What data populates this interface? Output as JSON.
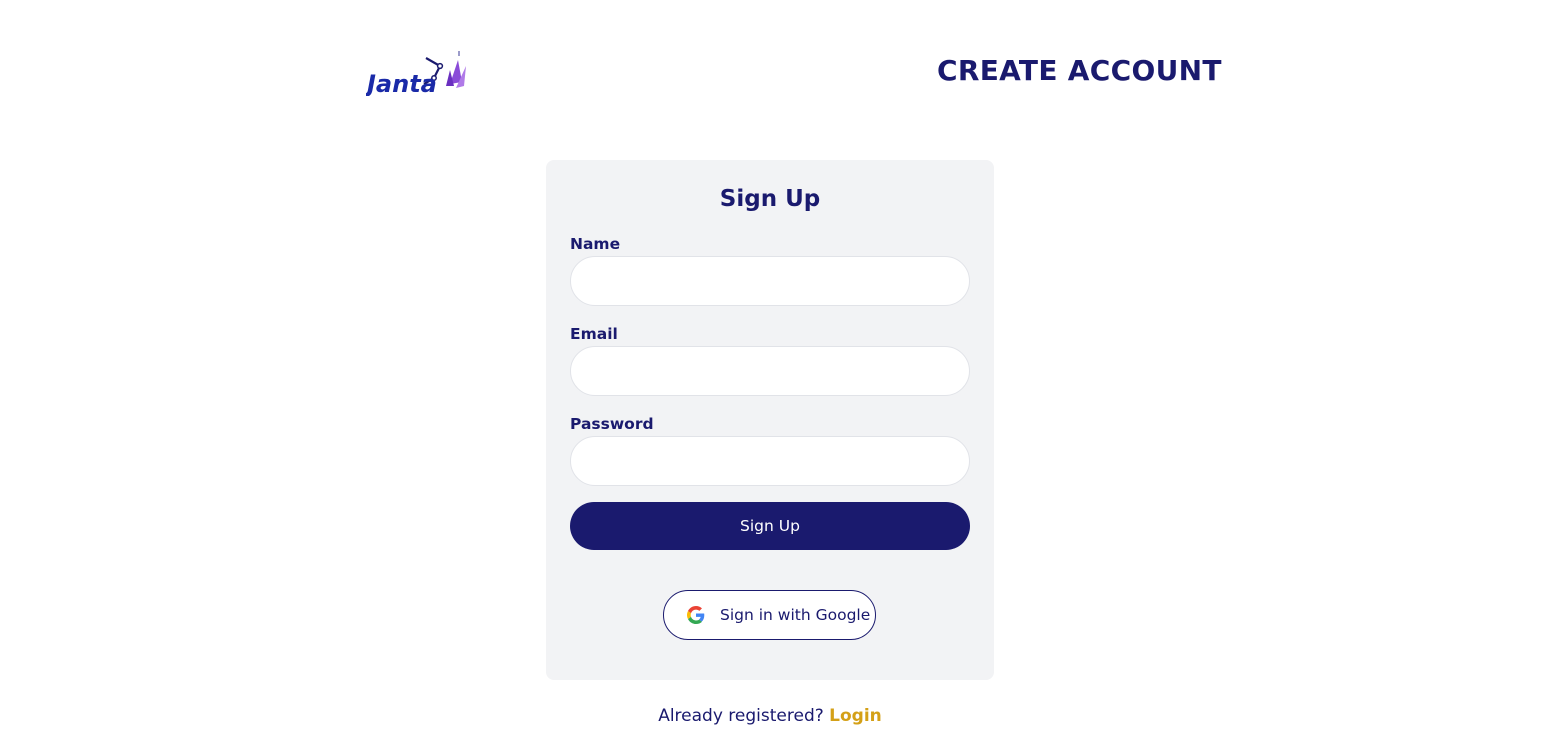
{
  "header": {
    "logo_text": "Janta",
    "page_title": "CREATE ACCOUNT"
  },
  "form": {
    "title": "Sign Up",
    "fields": [
      {
        "label": "Name",
        "value": "",
        "placeholder": ""
      },
      {
        "label": "Email",
        "value": "",
        "placeholder": ""
      },
      {
        "label": "Password",
        "value": "",
        "placeholder": ""
      }
    ],
    "submit_label": "Sign Up",
    "google_label": "Sign in with Google"
  },
  "footer": {
    "prompt": "Already registered?",
    "login_label": "Login"
  },
  "colors": {
    "primary": "#1a1a6e",
    "accent": "#d4a017",
    "card_bg": "#f2f3f5",
    "logo_purple": "#8a4bd8"
  },
  "icons": {
    "logo": "janta-logo-icon",
    "google": "google-icon"
  }
}
